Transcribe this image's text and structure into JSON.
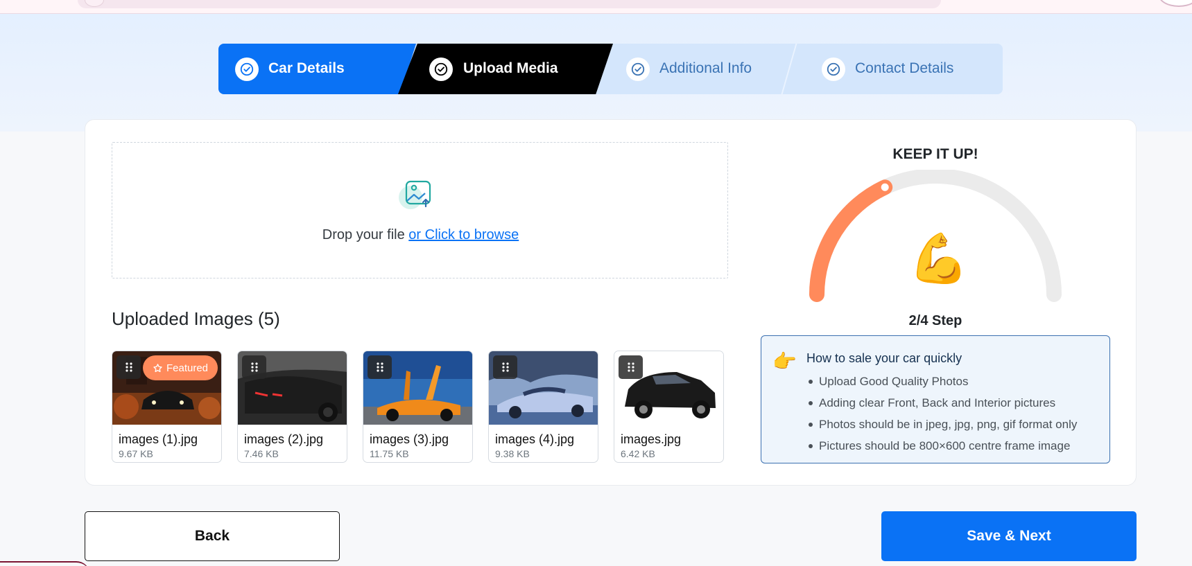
{
  "stepper": {
    "steps": [
      {
        "label": "Car Details",
        "state": "completed"
      },
      {
        "label": "Upload Media",
        "state": "active"
      },
      {
        "label": "Additional Info",
        "state": "pending"
      },
      {
        "label": "Contact Details",
        "state": "pending"
      }
    ]
  },
  "dropzone": {
    "text": "Drop your file ",
    "link": "or Click to browse",
    "icon": "image-upload-icon"
  },
  "uploaded": {
    "title": "Uploaded Images (5)",
    "featured_label": "Featured",
    "images": [
      {
        "name": "images (1).jpg",
        "size": "9.67 KB",
        "featured": true
      },
      {
        "name": "images (2).jpg",
        "size": "7.46 KB",
        "featured": false
      },
      {
        "name": "images (3).jpg",
        "size": "11.75 KB",
        "featured": false
      },
      {
        "name": "images (4).jpg",
        "size": "9.38 KB",
        "featured": false
      },
      {
        "name": "images.jpg",
        "size": "6.42 KB",
        "featured": false
      }
    ]
  },
  "progress": {
    "heading": "KEEP IT UP!",
    "current_step": 2,
    "total_steps": 4,
    "step_text": "2/4 Step",
    "emoji": "💪",
    "arc_color": "#ff8a5b",
    "track_color": "#ebebeb"
  },
  "tips": {
    "icon": "👉",
    "title": "How to sale your car quickly",
    "items": [
      "Upload Good Quality Photos",
      "Adding clear Front, Back and Interior pictures",
      "Photos should be in jpeg, jpg, png, gif format only",
      "Pictures should be 800×600 centre frame image"
    ]
  },
  "actions": {
    "back": "Back",
    "next": "Save & Next"
  },
  "colors": {
    "primary": "#0a72f5",
    "active_step": "#000000",
    "pending_step": "#d4e6fc",
    "featured_badge": "#ff8a5b"
  }
}
